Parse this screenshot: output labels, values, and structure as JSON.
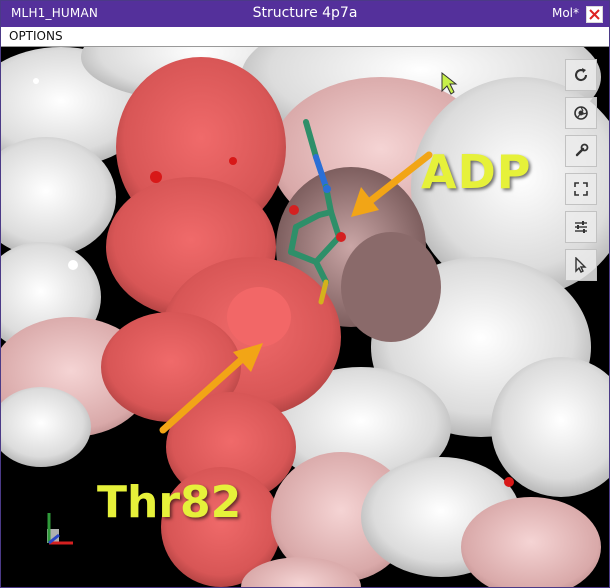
{
  "titlebar": {
    "left_text": "MLH1_HUMAN",
    "title": "Structure 4p7a",
    "app_label": "Mol*",
    "close_icon": "close-x-icon"
  },
  "menubar": {
    "options_label": "OPTIONS"
  },
  "toolbar": {
    "buttons": [
      {
        "icon": "reset-zoom-icon"
      },
      {
        "icon": "screenshot-icon"
      },
      {
        "icon": "settings-wrench-icon"
      },
      {
        "icon": "expand-icon"
      },
      {
        "icon": "controls-sliders-icon"
      },
      {
        "icon": "select-pointer-icon"
      }
    ]
  },
  "annotations": {
    "ligand_label": "ADP",
    "residue_label": "Thr82"
  },
  "colors": {
    "title_bg": "#54309b",
    "annotation_text": "#e6f13a",
    "arrow": "#f2a516",
    "surface_red": "#e05a5a",
    "surface_white": "#e8e8e8",
    "ligand_green": "#2a8a63"
  }
}
